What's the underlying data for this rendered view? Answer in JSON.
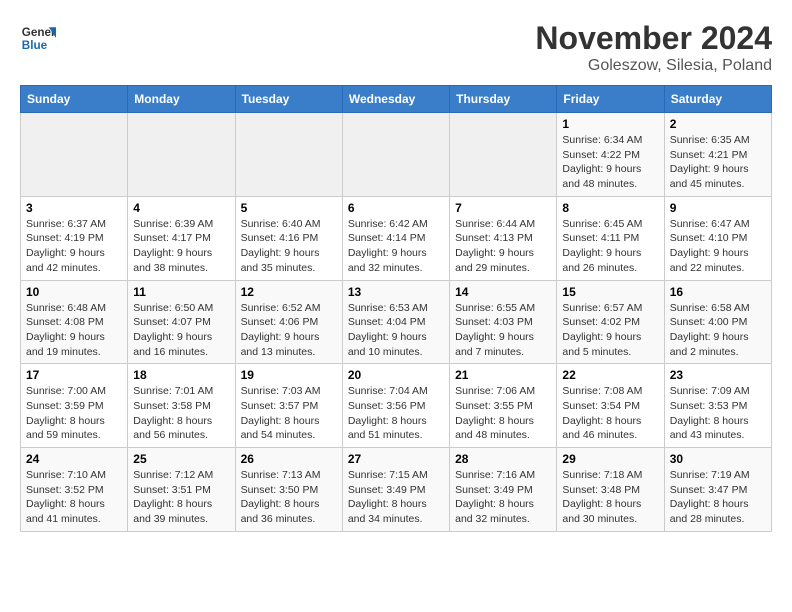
{
  "logo": {
    "text_general": "General",
    "text_blue": "Blue"
  },
  "title": "November 2024",
  "subtitle": "Goleszow, Silesia, Poland",
  "headers": [
    "Sunday",
    "Monday",
    "Tuesday",
    "Wednesday",
    "Thursday",
    "Friday",
    "Saturday"
  ],
  "weeks": [
    [
      {
        "day": "",
        "info": ""
      },
      {
        "day": "",
        "info": ""
      },
      {
        "day": "",
        "info": ""
      },
      {
        "day": "",
        "info": ""
      },
      {
        "day": "",
        "info": ""
      },
      {
        "day": "1",
        "info": "Sunrise: 6:34 AM\nSunset: 4:22 PM\nDaylight: 9 hours and 48 minutes."
      },
      {
        "day": "2",
        "info": "Sunrise: 6:35 AM\nSunset: 4:21 PM\nDaylight: 9 hours and 45 minutes."
      }
    ],
    [
      {
        "day": "3",
        "info": "Sunrise: 6:37 AM\nSunset: 4:19 PM\nDaylight: 9 hours and 42 minutes."
      },
      {
        "day": "4",
        "info": "Sunrise: 6:39 AM\nSunset: 4:17 PM\nDaylight: 9 hours and 38 minutes."
      },
      {
        "day": "5",
        "info": "Sunrise: 6:40 AM\nSunset: 4:16 PM\nDaylight: 9 hours and 35 minutes."
      },
      {
        "day": "6",
        "info": "Sunrise: 6:42 AM\nSunset: 4:14 PM\nDaylight: 9 hours and 32 minutes."
      },
      {
        "day": "7",
        "info": "Sunrise: 6:44 AM\nSunset: 4:13 PM\nDaylight: 9 hours and 29 minutes."
      },
      {
        "day": "8",
        "info": "Sunrise: 6:45 AM\nSunset: 4:11 PM\nDaylight: 9 hours and 26 minutes."
      },
      {
        "day": "9",
        "info": "Sunrise: 6:47 AM\nSunset: 4:10 PM\nDaylight: 9 hours and 22 minutes."
      }
    ],
    [
      {
        "day": "10",
        "info": "Sunrise: 6:48 AM\nSunset: 4:08 PM\nDaylight: 9 hours and 19 minutes."
      },
      {
        "day": "11",
        "info": "Sunrise: 6:50 AM\nSunset: 4:07 PM\nDaylight: 9 hours and 16 minutes."
      },
      {
        "day": "12",
        "info": "Sunrise: 6:52 AM\nSunset: 4:06 PM\nDaylight: 9 hours and 13 minutes."
      },
      {
        "day": "13",
        "info": "Sunrise: 6:53 AM\nSunset: 4:04 PM\nDaylight: 9 hours and 10 minutes."
      },
      {
        "day": "14",
        "info": "Sunrise: 6:55 AM\nSunset: 4:03 PM\nDaylight: 9 hours and 7 minutes."
      },
      {
        "day": "15",
        "info": "Sunrise: 6:57 AM\nSunset: 4:02 PM\nDaylight: 9 hours and 5 minutes."
      },
      {
        "day": "16",
        "info": "Sunrise: 6:58 AM\nSunset: 4:00 PM\nDaylight: 9 hours and 2 minutes."
      }
    ],
    [
      {
        "day": "17",
        "info": "Sunrise: 7:00 AM\nSunset: 3:59 PM\nDaylight: 8 hours and 59 minutes."
      },
      {
        "day": "18",
        "info": "Sunrise: 7:01 AM\nSunset: 3:58 PM\nDaylight: 8 hours and 56 minutes."
      },
      {
        "day": "19",
        "info": "Sunrise: 7:03 AM\nSunset: 3:57 PM\nDaylight: 8 hours and 54 minutes."
      },
      {
        "day": "20",
        "info": "Sunrise: 7:04 AM\nSunset: 3:56 PM\nDaylight: 8 hours and 51 minutes."
      },
      {
        "day": "21",
        "info": "Sunrise: 7:06 AM\nSunset: 3:55 PM\nDaylight: 8 hours and 48 minutes."
      },
      {
        "day": "22",
        "info": "Sunrise: 7:08 AM\nSunset: 3:54 PM\nDaylight: 8 hours and 46 minutes."
      },
      {
        "day": "23",
        "info": "Sunrise: 7:09 AM\nSunset: 3:53 PM\nDaylight: 8 hours and 43 minutes."
      }
    ],
    [
      {
        "day": "24",
        "info": "Sunrise: 7:10 AM\nSunset: 3:52 PM\nDaylight: 8 hours and 41 minutes."
      },
      {
        "day": "25",
        "info": "Sunrise: 7:12 AM\nSunset: 3:51 PM\nDaylight: 8 hours and 39 minutes."
      },
      {
        "day": "26",
        "info": "Sunrise: 7:13 AM\nSunset: 3:50 PM\nDaylight: 8 hours and 36 minutes."
      },
      {
        "day": "27",
        "info": "Sunrise: 7:15 AM\nSunset: 3:49 PM\nDaylight: 8 hours and 34 minutes."
      },
      {
        "day": "28",
        "info": "Sunrise: 7:16 AM\nSunset: 3:49 PM\nDaylight: 8 hours and 32 minutes."
      },
      {
        "day": "29",
        "info": "Sunrise: 7:18 AM\nSunset: 3:48 PM\nDaylight: 8 hours and 30 minutes."
      },
      {
        "day": "30",
        "info": "Sunrise: 7:19 AM\nSunset: 3:47 PM\nDaylight: 8 hours and 28 minutes."
      }
    ]
  ]
}
